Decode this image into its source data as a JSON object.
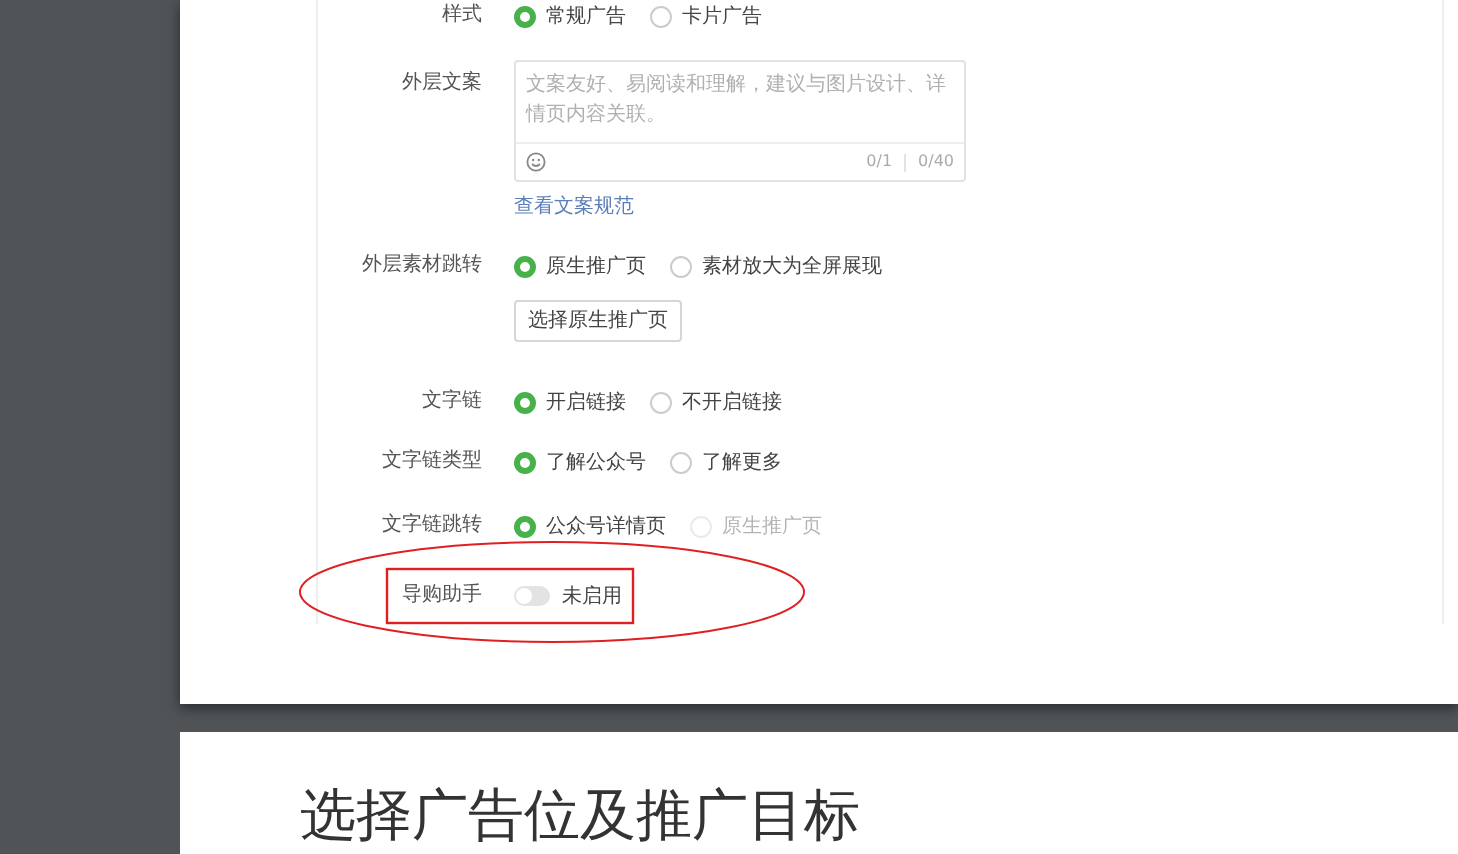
{
  "form": {
    "rows": [
      {
        "kind": "radio",
        "label": "样式",
        "options": [
          {
            "label": "常规广告",
            "selected": true,
            "disabled": false
          },
          {
            "label": "卡片广告",
            "selected": false,
            "disabled": false
          }
        ]
      },
      {
        "kind": "textarea",
        "label": "外层文案",
        "placeholder": "文案友好、易阅读和理解，建议与图片设计、详情页内容关联。",
        "count_1": "0/1",
        "count_2": "0/40",
        "link": "查看文案规范"
      },
      {
        "kind": "radio",
        "label": "外层素材跳转",
        "options": [
          {
            "label": "原生推广页",
            "selected": true,
            "disabled": false
          },
          {
            "label": "素材放大为全屏展现",
            "selected": false,
            "disabled": false
          }
        ],
        "button": "选择原生推广页"
      },
      {
        "kind": "radio",
        "label": "文字链",
        "options": [
          {
            "label": "开启链接",
            "selected": true,
            "disabled": false
          },
          {
            "label": "不开启链接",
            "selected": false,
            "disabled": false
          }
        ]
      },
      {
        "kind": "radio",
        "label": "文字链类型",
        "options": [
          {
            "label": "了解公众号",
            "selected": true,
            "disabled": false
          },
          {
            "label": "了解更多",
            "selected": false,
            "disabled": false
          }
        ]
      },
      {
        "kind": "radio",
        "label": "文字链跳转",
        "options": [
          {
            "label": "公众号详情页",
            "selected": true,
            "disabled": false
          },
          {
            "label": "原生推广页",
            "selected": false,
            "disabled": true
          }
        ]
      },
      {
        "kind": "toggle",
        "label": "导购助手",
        "on": false,
        "state_text": "未启用"
      }
    ]
  },
  "next_page": {
    "heading": "选择广告位及推广目标"
  }
}
